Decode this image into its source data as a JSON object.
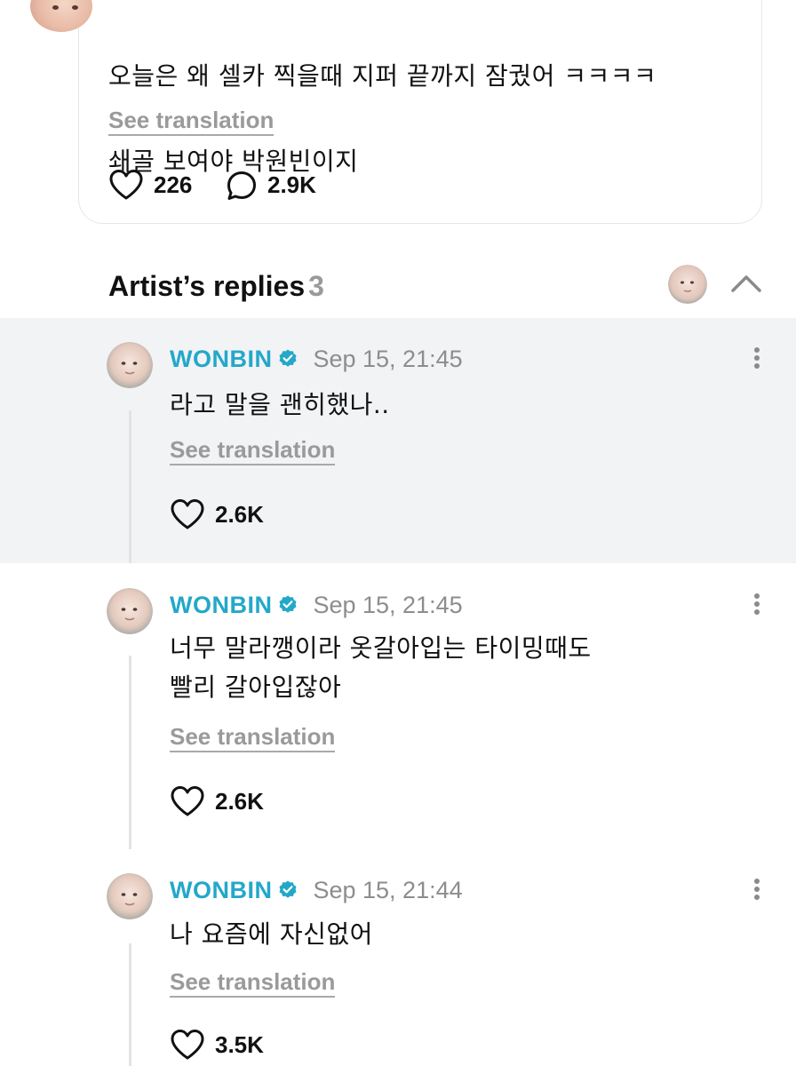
{
  "post": {
    "text_line1": "오늘은 왜 셀카 찍을때 지퍼 끝까지 잠궜어 ㅋㅋㅋㅋ",
    "text_line2": "쇄골 보여야 박원빈이지",
    "see_translation": "See translation",
    "likes": "226",
    "comments": "2.9K"
  },
  "section": {
    "title": "Artist’s replies",
    "count": "3"
  },
  "replies": [
    {
      "name": "WONBIN",
      "time": "Sep 15, 21:45",
      "text_lines": [
        "라고 말을 괜히했나.."
      ],
      "see_translation": "See translation",
      "likes": "2.6K"
    },
    {
      "name": "WONBIN",
      "time": "Sep 15, 21:45",
      "text_lines": [
        "너무 말라깽이라 옷갈아입는 타이밍때도",
        "빨리 갈아입잖아"
      ],
      "see_translation": "See translation",
      "likes": "2.6K"
    },
    {
      "name": "WONBIN",
      "time": "Sep 15, 21:44",
      "text_lines": [
        "나 요즘에 자신없어"
      ],
      "see_translation": "See translation",
      "likes": "3.5K"
    }
  ],
  "colors": {
    "artist_name": "#23a8c9",
    "verified_badge": "#23a8c9",
    "highlight_bg": "#f2f3f5",
    "muted_text": "#9a9a9a"
  },
  "icons": {
    "like": "heart-outline-icon",
    "comment": "speech-bubble-icon",
    "verified": "verified-badge-icon",
    "more": "vertical-ellipsis-icon",
    "collapse": "chevron-up-icon"
  }
}
